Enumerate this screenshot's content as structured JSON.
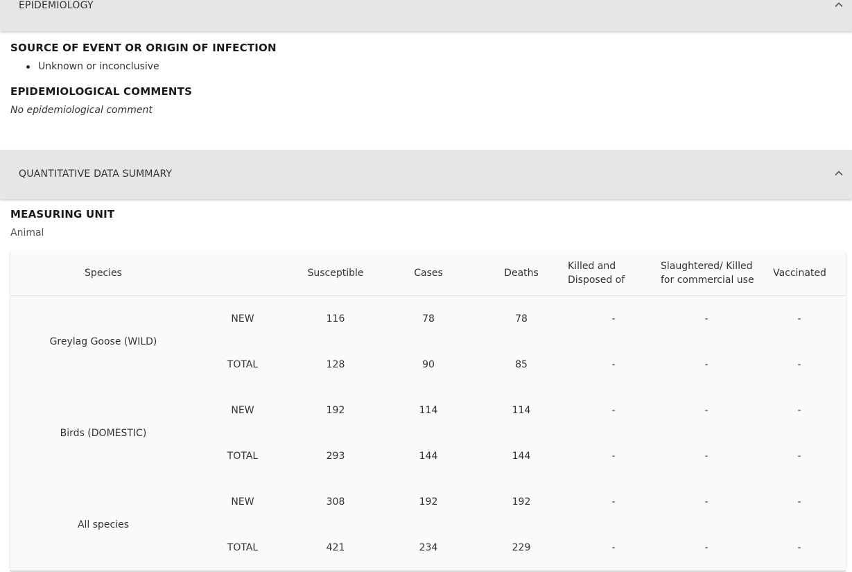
{
  "epidemiology": {
    "header_title": "EPIDEMIOLOGY",
    "source_title": "SOURCE OF EVENT OR ORIGIN OF INFECTION",
    "source_items": [
      "Unknown or inconclusive"
    ],
    "comments_title": "EPIDEMIOLOGICAL COMMENTS",
    "comments_text": "No epidemiological comment"
  },
  "quantitative": {
    "header_title": "QUANTITATIVE DATA SUMMARY",
    "measuring_unit_title": "MEASURING UNIT",
    "measuring_unit_value": "Animal",
    "columns": [
      "Species",
      "Susceptible",
      "Cases",
      "Deaths",
      "Killed and Disposed of",
      "Slaughtered/ Killed for commercial use",
      "Vaccinated"
    ],
    "rows": [
      {
        "species": "Greylag Goose (WILD)",
        "new": {
          "label": "NEW",
          "values": [
            "116",
            "78",
            "78",
            "-",
            "-",
            "-"
          ]
        },
        "total": {
          "label": "TOTAL",
          "values": [
            "128",
            "90",
            "85",
            "-",
            "-",
            "-"
          ]
        }
      },
      {
        "species": "Birds (DOMESTIC)",
        "new": {
          "label": "NEW",
          "values": [
            "192",
            "114",
            "114",
            "-",
            "-",
            "-"
          ]
        },
        "total": {
          "label": "TOTAL",
          "values": [
            "293",
            "144",
            "144",
            "-",
            "-",
            "-"
          ]
        }
      },
      {
        "species": "All species",
        "new": {
          "label": "NEW",
          "values": [
            "308",
            "192",
            "192",
            "-",
            "-",
            "-"
          ]
        },
        "total": {
          "label": "TOTAL",
          "values": [
            "421",
            "234",
            "229",
            "-",
            "-",
            "-"
          ]
        }
      }
    ]
  },
  "icons": {
    "collapse": "chevron-up-icon",
    "bullet": "bullet-dot-icon"
  }
}
